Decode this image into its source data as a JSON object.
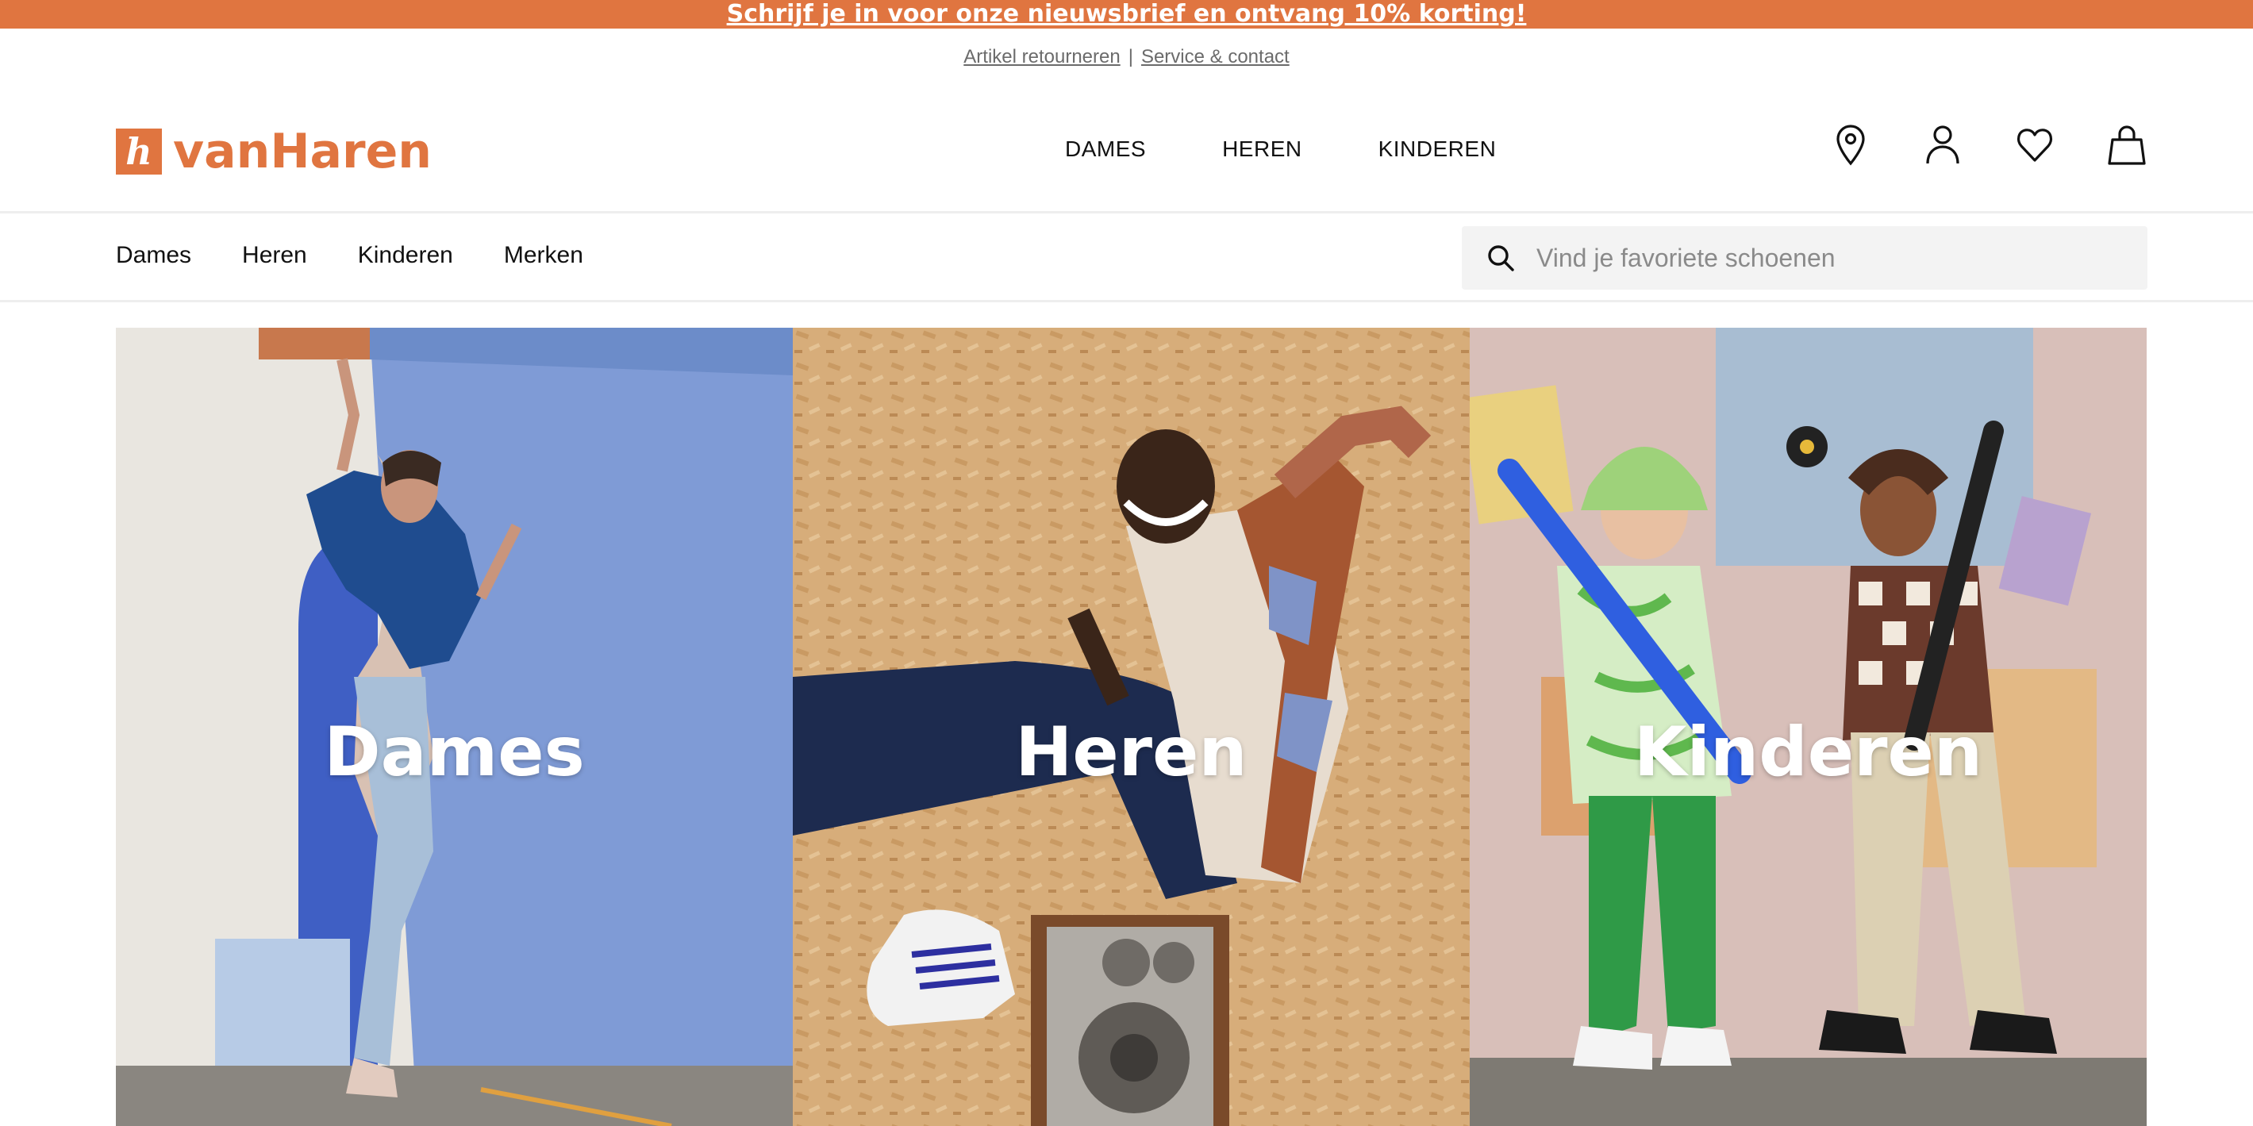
{
  "promo": {
    "text": "Schrijf je in voor onze nieuwsbrief en ontvang 10% korting!"
  },
  "utility": {
    "returns": "Artikel retourneren",
    "separator": "|",
    "service": "Service & contact"
  },
  "brand": {
    "name": "vanHaren",
    "mark": "h",
    "color": "#e07540"
  },
  "main_nav": [
    "DAMES",
    "HEREN",
    "KINDEREN"
  ],
  "header_icons": [
    "location-icon",
    "account-icon",
    "wishlist-heart-icon",
    "shopping-bag-icon"
  ],
  "sub_nav": [
    "Dames",
    "Heren",
    "Kinderen",
    "Merken"
  ],
  "search": {
    "placeholder": "Vind je favoriete schoenen"
  },
  "tiles": [
    {
      "label": "Dames"
    },
    {
      "label": "Heren"
    },
    {
      "label": "Kinderen"
    }
  ]
}
